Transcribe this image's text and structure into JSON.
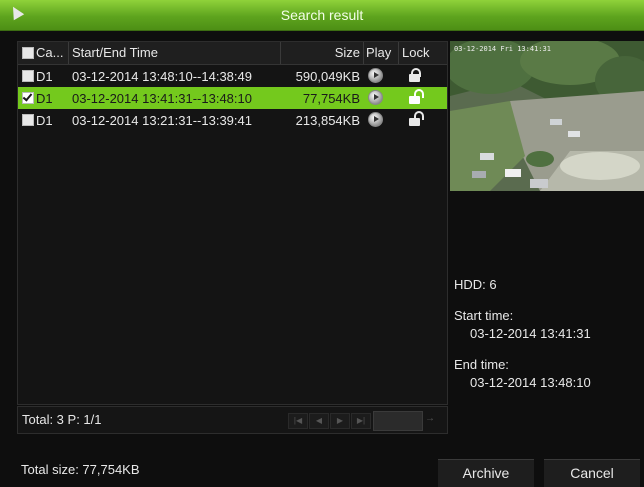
{
  "window": {
    "title": "Search result"
  },
  "table": {
    "headers": {
      "camera": "Ca...",
      "time": "Start/End Time",
      "size": "Size",
      "play": "Play",
      "lock": "Lock"
    },
    "rows": [
      {
        "camera": "D1",
        "time": "03-12-2014 13:48:10--14:38:49",
        "size": "590,049KB",
        "checked": false,
        "locked": true
      },
      {
        "camera": "D1",
        "time": "03-12-2014 13:41:31--13:48:10",
        "size": "77,754KB",
        "checked": true,
        "locked": false
      },
      {
        "camera": "D1",
        "time": "03-12-2014 13:21:31--13:39:41",
        "size": "213,854KB",
        "checked": false,
        "locked": false
      }
    ]
  },
  "pager": {
    "total": "Total: 3  P: 1/1"
  },
  "preview": {
    "timestamp": "03-12-2014 Fri 13:41:31"
  },
  "details": {
    "hdd": "HDD: 6",
    "start_label": "Start time:",
    "start_value": "03-12-2014 13:41:31",
    "end_label": "End time:",
    "end_value": "03-12-2014 13:48:10"
  },
  "footer": {
    "total_size": "Total size: 77,754KB",
    "archive": "Archive",
    "cancel": "Cancel"
  },
  "colors": {
    "accent": "#74c91d",
    "background": "#0e0e0e"
  }
}
